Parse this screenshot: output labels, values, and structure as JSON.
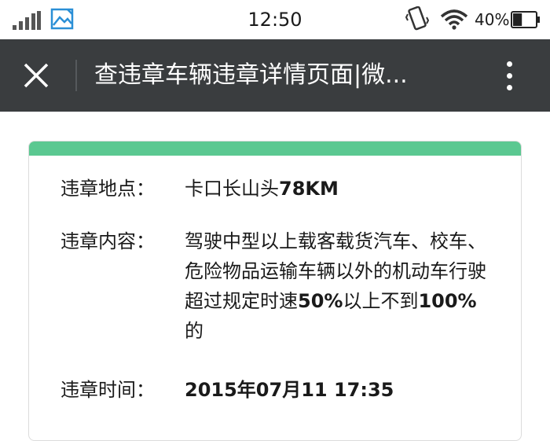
{
  "status_bar": {
    "time": "12:50",
    "battery_percent": "40%",
    "battery_level": 0.4,
    "icons": [
      "signal-icon",
      "gallery-icon",
      "vibrate-icon",
      "wifi-icon",
      "battery-icon"
    ]
  },
  "top_bar": {
    "title": "查违章车辆违章详情页面|微...",
    "close_icon": "close-icon",
    "more_icon": "more-vertical-icon"
  },
  "card": {
    "accent_color": "#5bc891",
    "location": {
      "label": "违章地点：",
      "value_prefix": "卡口长山头",
      "value_bold": "78KM"
    },
    "content": {
      "label": "违章内容：",
      "part1": "驾驶中型以上载客载货汽车、校车、危险物品运输车辆以外的机动车行驶超过规定时速",
      "bold1": "50%",
      "part2": "以上不到",
      "bold2": "100%",
      "part3": "的"
    },
    "time": {
      "label": "违章时间：",
      "value": "2015年07月11 17:35"
    }
  },
  "colors": {
    "top_bar_bg": "#3a3d3f",
    "text": "#1a1a1a"
  }
}
